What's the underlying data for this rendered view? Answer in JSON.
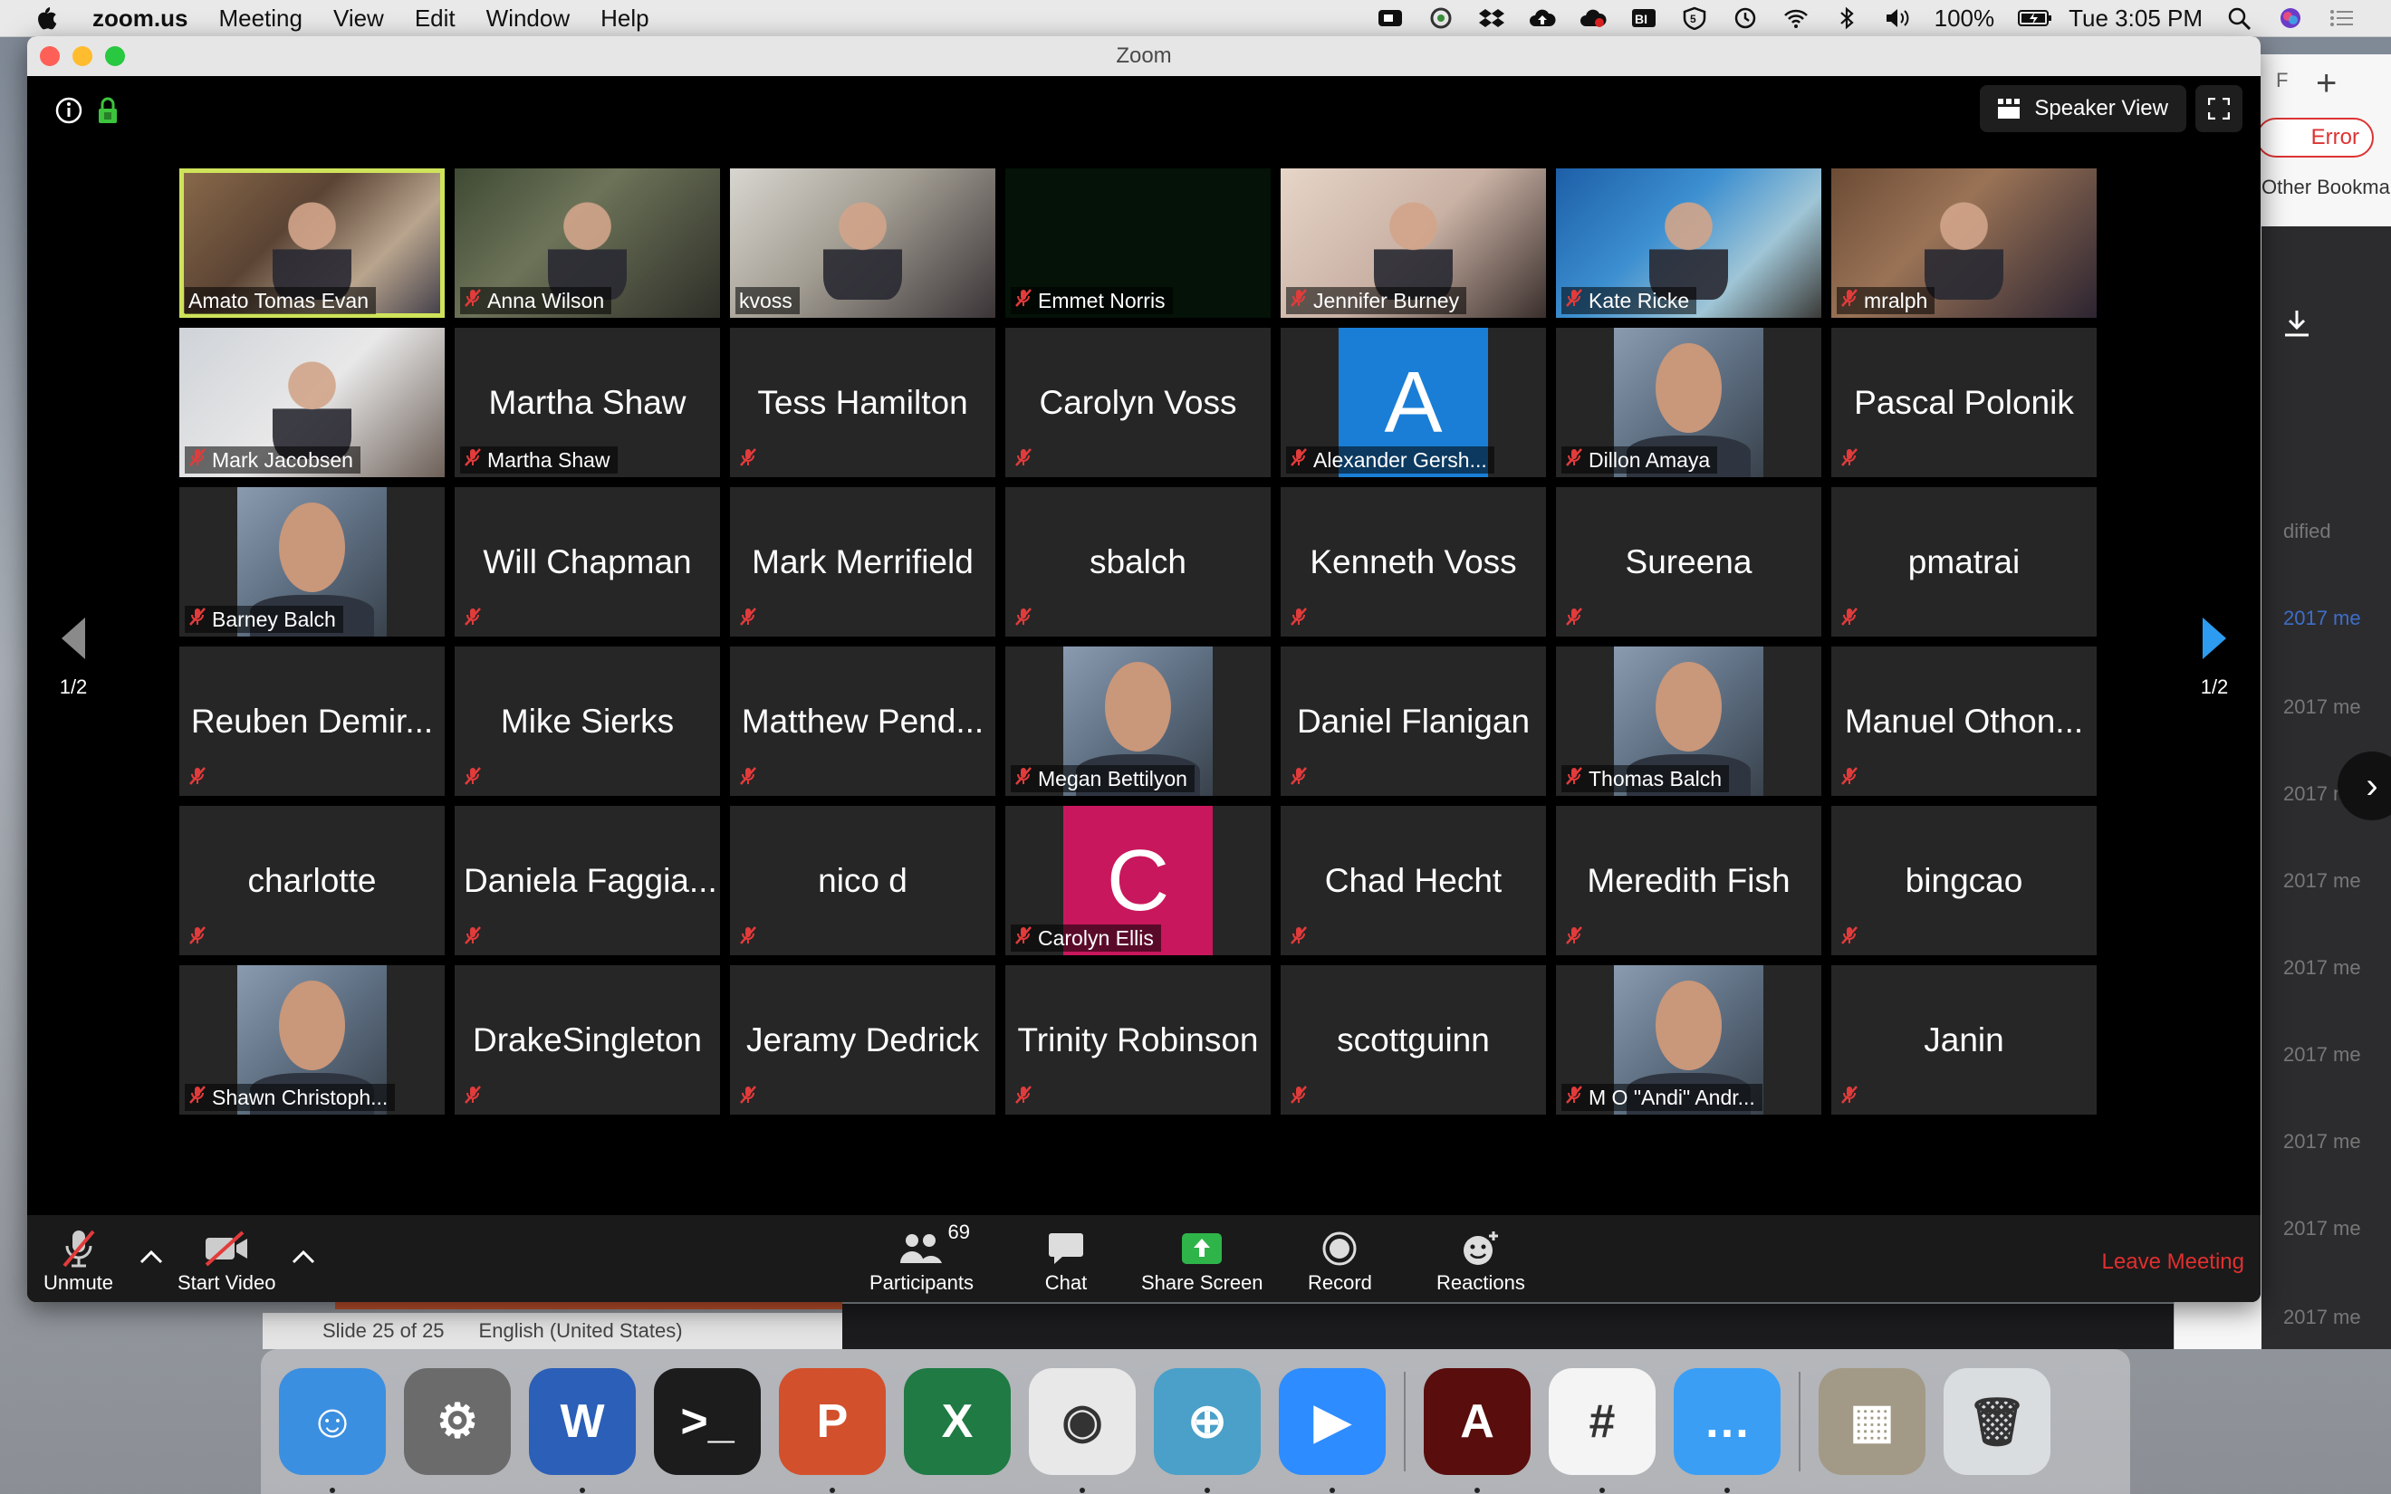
{
  "menubar": {
    "app": "zoom.us",
    "menus": [
      "Meeting",
      "View",
      "Edit",
      "Window",
      "Help"
    ],
    "battery": "100%",
    "clock": "Tue 3:05 PM"
  },
  "zoom": {
    "window_title": "Zoom",
    "speaker_view": "Speaker View",
    "page_indicator_left": "1/2",
    "page_indicator_right": "1/2",
    "participants": [
      {
        "name": "Amato Tomas Evan",
        "label": "Amato Tomas Evan",
        "kind": "video",
        "active": true,
        "muted": false
      },
      {
        "name": "Anna Wilson",
        "label": "Anna Wilson",
        "kind": "video",
        "muted": true
      },
      {
        "name": "kvoss",
        "label": "kvoss",
        "kind": "video",
        "muted": false
      },
      {
        "name": "Emmet Norris",
        "label": "Emmet Norris",
        "kind": "dark",
        "muted": true
      },
      {
        "name": "Jennifer Burney",
        "label": "Jennifer Burney",
        "kind": "video",
        "muted": true
      },
      {
        "name": "Kate Ricke",
        "label": "Kate Ricke",
        "kind": "video",
        "muted": true
      },
      {
        "name": "mralph",
        "label": "mralph",
        "kind": "video",
        "muted": true
      },
      {
        "name": "Mark Jacobsen",
        "label": "Mark Jacobsen",
        "kind": "video",
        "muted": true
      },
      {
        "name": "Martha Shaw",
        "label": "Martha Shaw",
        "kind": "name",
        "muted": true
      },
      {
        "name": "Tess Hamilton",
        "label": "",
        "kind": "name",
        "muted": true
      },
      {
        "name": "Carolyn Voss",
        "label": "",
        "kind": "name",
        "muted": true
      },
      {
        "name": "Alexander Gersh...",
        "label": "Alexander Gersh...",
        "kind": "letter",
        "letter": "A",
        "color": "#1a7ed6",
        "muted": true
      },
      {
        "name": "Dillon Amaya",
        "label": "Dillon Amaya",
        "kind": "photo",
        "muted": true
      },
      {
        "name": "Pascal Polonik",
        "label": "",
        "kind": "name",
        "muted": true
      },
      {
        "name": "Barney Balch",
        "label": "Barney Balch",
        "kind": "photo",
        "muted": true
      },
      {
        "name": "Will Chapman",
        "label": "",
        "kind": "name",
        "muted": true
      },
      {
        "name": "Mark Merrifield",
        "label": "",
        "kind": "name",
        "muted": true
      },
      {
        "name": "sbalch",
        "label": "",
        "kind": "name",
        "muted": true
      },
      {
        "name": "Kenneth Voss",
        "label": "",
        "kind": "name",
        "muted": true
      },
      {
        "name": "Sureena",
        "label": "",
        "kind": "name",
        "muted": true
      },
      {
        "name": "pmatrai",
        "label": "",
        "kind": "name",
        "muted": true
      },
      {
        "name": "Reuben Demir...",
        "label": "",
        "kind": "name",
        "muted": true
      },
      {
        "name": "Mike Sierks",
        "label": "",
        "kind": "name",
        "muted": true
      },
      {
        "name": "Matthew Pend...",
        "label": "",
        "kind": "name",
        "muted": true
      },
      {
        "name": "Megan Bettilyon",
        "label": "Megan Bettilyon",
        "kind": "photo",
        "muted": true
      },
      {
        "name": "Daniel Flanigan",
        "label": "",
        "kind": "name",
        "muted": true
      },
      {
        "name": "Thomas Balch",
        "label": "Thomas Balch",
        "kind": "photo",
        "muted": true
      },
      {
        "name": "Manuel Othon...",
        "label": "",
        "kind": "name",
        "muted": true
      },
      {
        "name": "charlotte",
        "label": "",
        "kind": "name",
        "muted": true
      },
      {
        "name": "Daniela Faggia...",
        "label": "",
        "kind": "name",
        "muted": true
      },
      {
        "name": "nico d",
        "label": "",
        "kind": "name",
        "muted": true
      },
      {
        "name": "Carolyn Ellis",
        "label": "Carolyn Ellis",
        "kind": "letter",
        "letter": "C",
        "color": "#c8175c",
        "muted": true
      },
      {
        "name": "Chad Hecht",
        "label": "",
        "kind": "name",
        "muted": true
      },
      {
        "name": "Meredith Fish",
        "label": "",
        "kind": "name",
        "muted": true
      },
      {
        "name": "bingcao",
        "label": "",
        "kind": "name",
        "muted": true
      },
      {
        "name": "Shawn Christoph...",
        "label": "Shawn Christoph...",
        "kind": "photo",
        "muted": true
      },
      {
        "name": "DrakeSingleton",
        "label": "",
        "kind": "name",
        "muted": true
      },
      {
        "name": "Jeramy Dedrick",
        "label": "",
        "kind": "name",
        "muted": true
      },
      {
        "name": "Trinity Robinson",
        "label": "",
        "kind": "name",
        "muted": true
      },
      {
        "name": "scottguinn",
        "label": "",
        "kind": "name",
        "muted": true
      },
      {
        "name": "M O \"Andi\" Andr...",
        "label": "M O \"Andi\" Andr...",
        "kind": "photo",
        "muted": true
      },
      {
        "name": "Janin",
        "label": "",
        "kind": "name",
        "muted": true
      }
    ],
    "toolbar": {
      "unmute": "Unmute",
      "start_video": "Start Video",
      "participants": "Participants",
      "participants_count": "69",
      "chat": "Chat",
      "share_screen": "Share Screen",
      "record": "Record",
      "reactions": "Reactions",
      "leave": "Leave Meeting"
    }
  },
  "background": {
    "error": "Error",
    "bookmarks": "Other Bookmar",
    "tab_letter": "F",
    "modified": "dified",
    "row_texts": [
      "2017 me",
      "2017 me",
      "2017 me",
      "2017 me",
      "2017 me",
      "2017 me",
      "2017 me",
      "2017 me",
      "2017 me"
    ],
    "slide_status": "Slide 25 of 25",
    "language": "English (United States)"
  },
  "dock": {
    "apps": [
      {
        "name": "finder-app",
        "color": "#3b8fe0",
        "glyph": "☺",
        "running": true
      },
      {
        "name": "system-preferences-app",
        "color": "#6b6b6b",
        "glyph": "⚙",
        "running": false
      },
      {
        "name": "word-app",
        "color": "#2b5fb8",
        "glyph": "W",
        "running": true
      },
      {
        "name": "terminal-app",
        "color": "#1c1c1c",
        "glyph": ">_",
        "running": false
      },
      {
        "name": "powerpoint-app",
        "color": "#d2502c",
        "glyph": "P",
        "running": true
      },
      {
        "name": "excel-app",
        "color": "#1f7a44",
        "glyph": "X",
        "running": false
      },
      {
        "name": "chrome-app",
        "color": "#e8e8e8",
        "glyph": "◉",
        "running": true
      },
      {
        "name": "vpn-app",
        "color": "#4aa0c8",
        "glyph": "⊕",
        "running": true
      },
      {
        "name": "zoom-app",
        "color": "#2d8cff",
        "glyph": "▶",
        "running": true
      },
      {
        "name": "acrobat-app",
        "color": "#5a0d0d",
        "glyph": "A",
        "running": true
      },
      {
        "name": "slack-app",
        "color": "#f4f4f4",
        "glyph": "#",
        "running": true
      },
      {
        "name": "messages-app",
        "color": "#3a9ef5",
        "glyph": "…",
        "running": true
      },
      {
        "name": "photos-folder",
        "color": "#a29a86",
        "glyph": "▦",
        "running": false
      },
      {
        "name": "trash-app",
        "color": "#d9dde0",
        "glyph": "🗑",
        "running": false
      }
    ]
  }
}
